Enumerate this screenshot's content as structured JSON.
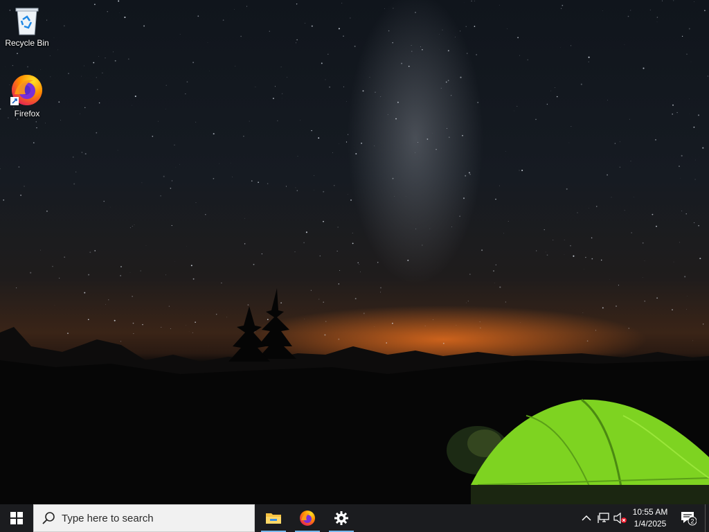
{
  "desktop": {
    "icons": [
      {
        "label": "Recycle Bin",
        "icon": "recycle-bin-icon"
      },
      {
        "label": "Firefox",
        "icon": "firefox-icon"
      }
    ]
  },
  "taskbar": {
    "start_icon": "windows-logo-icon",
    "search": {
      "placeholder": "Type here to search",
      "icon": "search-icon"
    },
    "pinned": [
      {
        "name": "File Explorer",
        "icon": "folder-icon",
        "active": true
      },
      {
        "name": "Firefox",
        "icon": "firefox-icon",
        "active": true
      },
      {
        "name": "Settings",
        "icon": "gear-icon",
        "active": true
      }
    ],
    "tray": {
      "icons": [
        "chevron-up-icon",
        "network-icon",
        "volume-muted-icon"
      ],
      "time": "10:55 AM",
      "date": "1/4/2025",
      "notification_count": "2"
    }
  },
  "colors": {
    "taskbar": "#1b1c1f",
    "active_indicator": "#76b9ed",
    "tent": "#7ed321"
  }
}
